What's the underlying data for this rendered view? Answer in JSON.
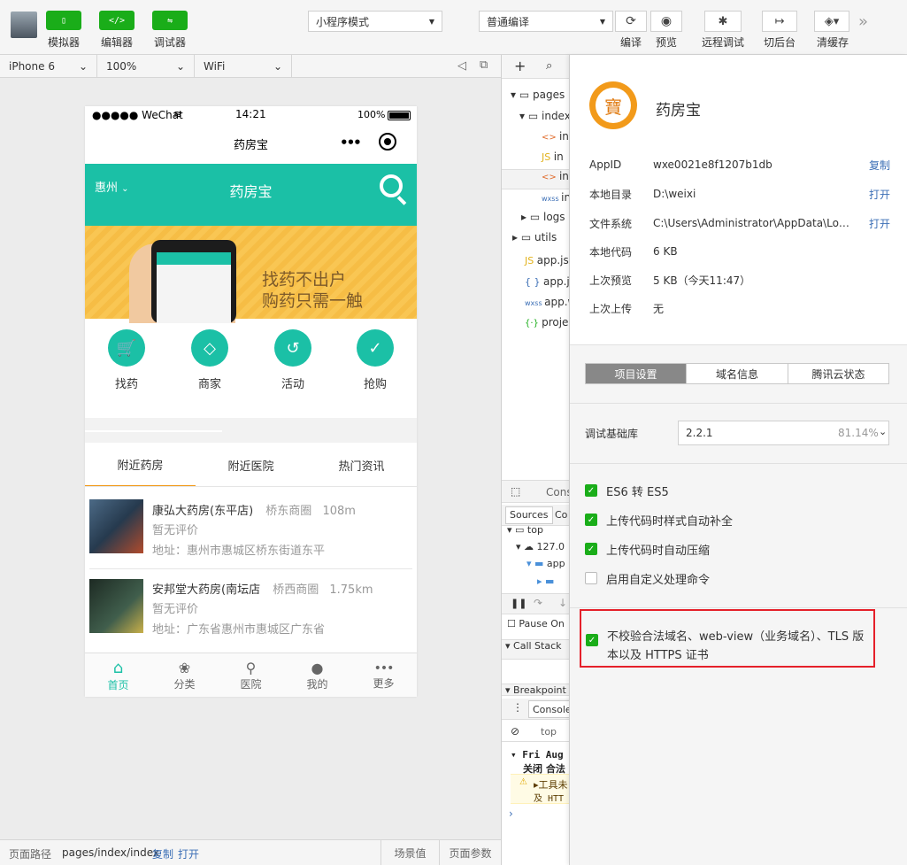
{
  "toolbar": {
    "simulator": "模拟器",
    "editor": "编辑器",
    "debugger": "调试器",
    "mode_select": "小程序模式",
    "compile_select": "普通编译",
    "compile": "编译",
    "preview": "预览",
    "remote_debug": "远程调试",
    "background": "切后台",
    "clear_cache": "清缓存",
    "more": "»"
  },
  "device_bar": {
    "device": "iPhone 6",
    "zoom": "100%",
    "network": "WiFi"
  },
  "phone": {
    "carrier": "●●●●● WeChat",
    "time": "14:21",
    "battery": "100%",
    "nav_title": "药房宝",
    "header_city": "惠州",
    "header_title": "药房宝",
    "banner_text_1": "找药不出户",
    "banner_text_2": "购药只需一触",
    "grid": [
      {
        "label": "找药",
        "icon": "cart-icon"
      },
      {
        "label": "商家",
        "icon": "diamond-icon"
      },
      {
        "label": "活动",
        "icon": "refresh-icon"
      },
      {
        "label": "抢购",
        "icon": "check-icon"
      }
    ],
    "tabs": [
      "附近药房",
      "附近医院",
      "热门资讯"
    ],
    "stores": [
      {
        "name": "康弘大药房(东平店)",
        "area": "桥东商圈",
        "distance": "108m",
        "rating": "暂无评价",
        "address": "地址：惠州市惠城区桥东街道东平"
      },
      {
        "name": "安邦堂大药房(南坛店",
        "area": "桥西商圈",
        "distance": "1.75km",
        "rating": "暂无评价",
        "address": "地址：广东省惠州市惠城区广东省"
      }
    ],
    "tabbar": [
      {
        "label": "首页",
        "icon": "home-icon"
      },
      {
        "label": "分类",
        "icon": "paw-icon"
      },
      {
        "label": "医院",
        "icon": "location-icon"
      },
      {
        "label": "我的",
        "icon": "user-icon"
      },
      {
        "label": "更多",
        "icon": "more-icon"
      }
    ]
  },
  "bottom_bar": {
    "path_label": "页面路径",
    "path": "pages/index/index",
    "copy": "复制",
    "open": "打开",
    "scene": "场景值",
    "params": "页面参数"
  },
  "devtools": {
    "tree": [
      {
        "label": "pages",
        "indent": 1
      },
      {
        "label": "index",
        "indent": 2
      },
      {
        "label": "in",
        "indent": 3,
        "badge": "<>"
      },
      {
        "label": "in",
        "indent": 3,
        "badge": "JS"
      },
      {
        "label": "in",
        "indent": 3,
        "badge": "<>"
      },
      {
        "label": "in",
        "indent": 3,
        "badge": "wxss"
      },
      {
        "label": "logs",
        "indent": 2
      },
      {
        "label": "utils",
        "indent": 1
      },
      {
        "label": "app.js",
        "indent": 1,
        "badge": "JS"
      },
      {
        "label": "app.js",
        "indent": 1,
        "badge": "{}"
      },
      {
        "label": "app.w",
        "indent": 1,
        "badge": "wxss"
      },
      {
        "label": "proje",
        "indent": 1,
        "badge": "{·}"
      }
    ],
    "console_tab": "Cons",
    "sources_tab": "Sources",
    "co_tab": "Co",
    "top": "top",
    "host": "127.0",
    "app_folder": "app",
    "pause": "Pause On",
    "call_stack": "Call Stack",
    "breakpoints": "Breakpoint",
    "console": "Console",
    "console_top": "top",
    "log_date": "Fri Aug",
    "log_msg": "关闭 合法",
    "warn1": "▸工具未",
    "warn2": "及 HTT"
  },
  "panel": {
    "app_name": "药房宝",
    "logo_char": "寶",
    "info": [
      {
        "label": "AppID",
        "value": "wxe0021e8f1207b1db",
        "action": "复制"
      },
      {
        "label": "本地目录",
        "value": "D:\\weixi",
        "action": "打开"
      },
      {
        "label": "文件系统",
        "value": "C:\\Users\\Administrator\\AppData\\Local\\...",
        "action": "打开"
      },
      {
        "label": "本地代码",
        "value": "6 KB",
        "action": ""
      },
      {
        "label": "上次预览",
        "value": "5 KB（今天11:47）",
        "action": ""
      },
      {
        "label": "上次上传",
        "value": "无",
        "action": ""
      }
    ],
    "segments": [
      "项目设置",
      "域名信息",
      "腾讯云状态"
    ],
    "lib_label": "调试基础库",
    "lib_version": "2.2.1",
    "lib_percent": "81.14%",
    "options": [
      {
        "label": "ES6 转 ES5",
        "checked": true
      },
      {
        "label": "上传代码时样式自动补全",
        "checked": true
      },
      {
        "label": "上传代码时自动压缩",
        "checked": true
      },
      {
        "label": "启用自定义处理命令",
        "checked": false
      }
    ],
    "highlight_line1": "不校验合法域名、web-view（业务域名）、TLS 版",
    "highlight_line2": "本以及 HTTPS 证书",
    "colors": {
      "accent": "#1aad19",
      "teal": "#1bc0a6",
      "link": "#3c6fb6",
      "highlight": "#e5202a"
    }
  }
}
